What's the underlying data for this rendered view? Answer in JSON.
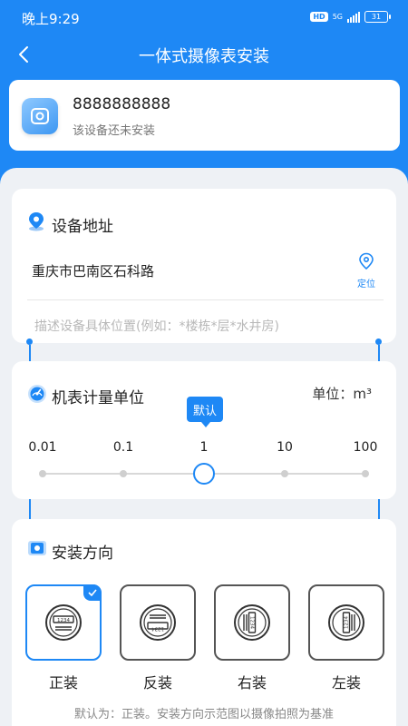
{
  "status_bar": {
    "time": "晚上9:29",
    "hd": "HD",
    "network": "5G",
    "battery": "31"
  },
  "nav": {
    "title": "一体式摄像表安装"
  },
  "device": {
    "id": "8888888888",
    "status": "该设备还未安装"
  },
  "address_section": {
    "title": "设备地址",
    "address": "重庆市巴南区石科路",
    "locate_label": "定位",
    "detail_placeholder": "描述设备具体位置(例如：*楼栋*层*水井房)"
  },
  "unit_section": {
    "title": "机表计量单位",
    "unit_label": "单位：m³",
    "default_tooltip": "默认",
    "ticks": [
      "0.01",
      "0.1",
      "1",
      "10",
      "100"
    ],
    "selected_index": 2
  },
  "direction_section": {
    "title": "安装方向",
    "options": [
      {
        "label": "正装",
        "selected": true,
        "icon": "meter-upright-icon"
      },
      {
        "label": "反装",
        "selected": false,
        "icon": "meter-inverted-icon"
      },
      {
        "label": "右装",
        "selected": false,
        "icon": "meter-right-icon"
      },
      {
        "label": "左装",
        "selected": false,
        "icon": "meter-left-icon"
      }
    ],
    "hint": "默认为：正装。安装方向示范图以摄像拍照为基准"
  },
  "colors": {
    "accent": "#1E88F5",
    "background": "#EEF1F5"
  }
}
